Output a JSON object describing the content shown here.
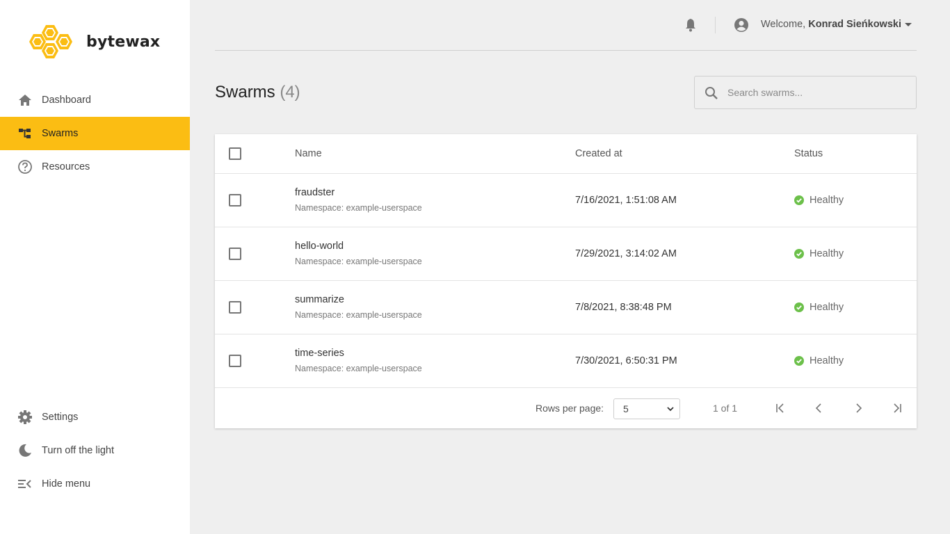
{
  "brand": {
    "name": "bytewax",
    "accent": "#fbbd13"
  },
  "sidebar": {
    "items": [
      {
        "label": "Dashboard",
        "icon": "home-icon",
        "active": false
      },
      {
        "label": "Swarms",
        "icon": "hierarchy-icon",
        "active": true
      },
      {
        "label": "Resources",
        "icon": "help-circle-icon",
        "active": false
      }
    ],
    "bottom_items": [
      {
        "label": "Settings",
        "icon": "gear-icon"
      },
      {
        "label": "Turn off the light",
        "icon": "moon-icon"
      },
      {
        "label": "Hide menu",
        "icon": "menu-collapse-icon"
      }
    ]
  },
  "header": {
    "welcome_prefix": "Welcome,",
    "user_name": "Konrad Sieńkowski"
  },
  "page": {
    "title": "Swarms",
    "count": "(4)"
  },
  "search": {
    "placeholder": "Search swarms..."
  },
  "table": {
    "columns": [
      "Name",
      "Created at",
      "Status"
    ],
    "rows": [
      {
        "name": "fraudster",
        "namespace": "Namespace: example-userspace",
        "created": "7/16/2021, 1:51:08 AM",
        "status": "Healthy"
      },
      {
        "name": "hello-world",
        "namespace": "Namespace: example-userspace",
        "created": "7/29/2021, 3:14:02 AM",
        "status": "Healthy"
      },
      {
        "name": "summarize",
        "namespace": "Namespace: example-userspace",
        "created": "7/8/2021, 8:38:48 PM",
        "status": "Healthy"
      },
      {
        "name": "time-series",
        "namespace": "Namespace: example-userspace",
        "created": "7/30/2021, 6:50:31 PM",
        "status": "Healthy"
      }
    ],
    "status_color": "#6cc04a"
  },
  "pagination": {
    "rows_per_page_label": "Rows per page:",
    "rows_per_page_value": "5",
    "page_info": "1 of 1"
  }
}
